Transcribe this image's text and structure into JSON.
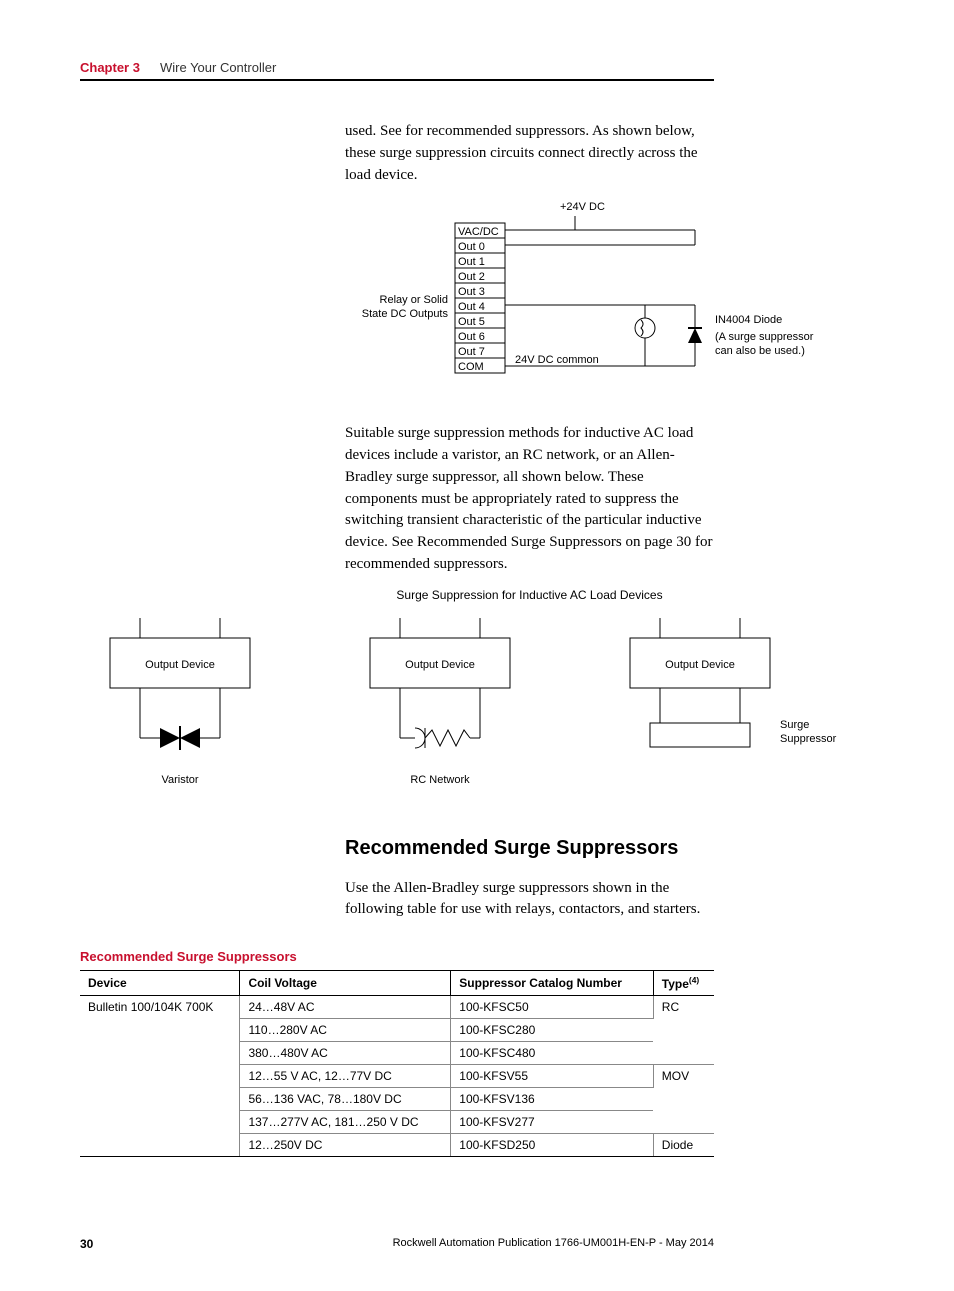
{
  "header": {
    "chapter_label": "Chapter 3",
    "chapter_title": "Wire Your Controller"
  },
  "paragraphs": {
    "p1": "used. See for recommended suppressors. As shown below, these surge suppression circuits connect directly across the load device.",
    "p2": "Suitable surge suppression methods for inductive AC load devices include a varistor, an RC network, or an Allen-Bradley surge suppressor, all shown below. These components must be appropriately rated to suppress the switching transient characteristic of the particular inductive device. See Recommended Surge Suppressors on page 30 for recommended suppressors.",
    "p3": "Use the Allen-Bradley surge suppressors shown in the following table for use with relays, contactors, and starters."
  },
  "diagram1": {
    "top_label": "+24V DC",
    "left_label_1": "Relay or Solid",
    "left_label_2": "State DC Outputs",
    "rows": [
      "VAC/DC",
      "Out 0",
      "Out 1",
      "Out 2",
      "Out 3",
      "Out 4",
      "Out 5",
      "Out 6",
      "Out 7",
      "COM"
    ],
    "common_label": "24V DC common",
    "diode_label": "IN4004 Diode",
    "diode_note1": "(A surge suppressor",
    "diode_note2": "can also be used.)"
  },
  "diagram2": {
    "caption": "Surge Suppression for Inductive AC Load Devices",
    "output_device": "Output Device",
    "varistor": "Varistor",
    "rc_network": "RC Network",
    "surge1": "Surge",
    "surge2": "Suppressor"
  },
  "section_heading": "Recommended Surge Suppressors",
  "table": {
    "title": "Recommended Surge Suppressors",
    "headers": {
      "device": "Device",
      "coil": "Coil Voltage",
      "catalog": "Suppressor Catalog Number",
      "type": "Type",
      "type_sup": "(4)"
    },
    "device_name": "Bulletin 100/104K 700K",
    "rows": [
      {
        "coil": "24…48V AC",
        "catalog": "100-KFSC50"
      },
      {
        "coil": "110…280V AC",
        "catalog": "100-KFSC280"
      },
      {
        "coil": "380…480V AC",
        "catalog": "100-KFSC480"
      },
      {
        "coil": "12…55 V AC, 12…77V DC",
        "catalog": "100-KFSV55"
      },
      {
        "coil": "56…136 VAC, 78…180V DC",
        "catalog": "100-KFSV136"
      },
      {
        "coil": "137…277V AC, 181…250 V DC",
        "catalog": "100-KFSV277"
      },
      {
        "coil": "12…250V DC",
        "catalog": "100-KFSD250"
      }
    ],
    "types": {
      "rc": "RC",
      "mov": "MOV",
      "diode": "Diode"
    }
  },
  "footer": {
    "page": "30",
    "pub": "Rockwell Automation Publication 1766-UM001H-EN-P - May 2014"
  }
}
